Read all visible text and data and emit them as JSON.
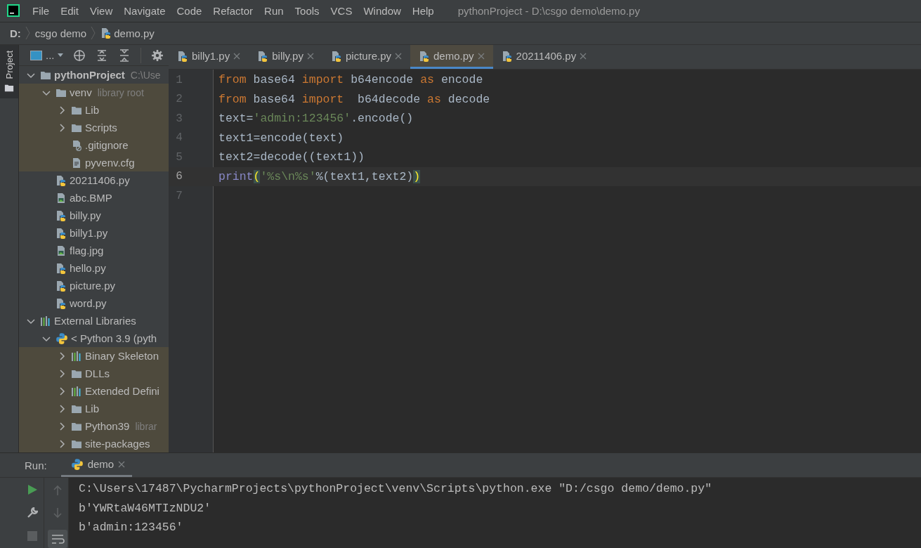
{
  "menu": [
    "File",
    "Edit",
    "View",
    "Navigate",
    "Code",
    "Refactor",
    "Run",
    "Tools",
    "VCS",
    "Window",
    "Help"
  ],
  "window": {
    "title": "pythonProject - D:\\csgo demo\\demo.py"
  },
  "breadcrumb": [
    {
      "label": "D:",
      "kind": "drive"
    },
    {
      "label": "csgo demo",
      "kind": "folder"
    },
    {
      "label": "demo.py",
      "kind": "python"
    }
  ],
  "side_tab": {
    "label": "Project",
    "selected": true
  },
  "project_toolbar": {
    "view_label": "..."
  },
  "tree": [
    {
      "label": "pythonProject",
      "hint": "C:\\Use",
      "kind": "folder",
      "expanded": true,
      "library": false,
      "bold": true,
      "children": [
        {
          "label": "venv",
          "hint": "library root",
          "kind": "folder",
          "expanded": true,
          "library": true,
          "children": [
            {
              "label": "Lib",
              "kind": "folder",
              "expanded": false,
              "library": true
            },
            {
              "label": "Scripts",
              "kind": "folder",
              "expanded": false,
              "library": true
            },
            {
              "label": ".gitignore",
              "kind": "ignored",
              "library": true
            },
            {
              "label": "pyvenv.cfg",
              "kind": "text",
              "library": true
            }
          ]
        },
        {
          "label": "20211406.py",
          "kind": "python",
          "library": false
        },
        {
          "label": "abc.BMP",
          "kind": "image",
          "library": false
        },
        {
          "label": "billy.py",
          "kind": "python",
          "library": false
        },
        {
          "label": "billy1.py",
          "kind": "python",
          "library": false
        },
        {
          "label": "flag.jpg",
          "kind": "image",
          "library": false
        },
        {
          "label": "hello.py",
          "kind": "python",
          "library": false
        },
        {
          "label": "picture.py",
          "kind": "python",
          "library": false
        },
        {
          "label": "word.py",
          "kind": "python",
          "library": false
        }
      ]
    },
    {
      "label": "External Libraries",
      "kind": "libraries",
      "expanded": true,
      "library": false,
      "children": [
        {
          "label": "< Python 3.9 (pyth",
          "kind": "sdk",
          "expanded": true,
          "library": false,
          "children": [
            {
              "label": "Binary Skeleton",
              "kind": "libraries",
              "expanded": false,
              "library": true
            },
            {
              "label": "DLLs",
              "kind": "folder",
              "expanded": false,
              "library": true
            },
            {
              "label": "Extended Defini",
              "kind": "libraries",
              "expanded": false,
              "library": true
            },
            {
              "label": "Lib",
              "kind": "folder",
              "expanded": false,
              "library": true
            },
            {
              "label": "Python39",
              "hint": "librar",
              "kind": "folder",
              "expanded": false,
              "library": true
            },
            {
              "label": "site-packages",
              "kind": "folder",
              "expanded": false,
              "library": true
            }
          ]
        }
      ]
    }
  ],
  "tabs": [
    {
      "label": "billy1.py",
      "selected": false
    },
    {
      "label": "billy.py",
      "selected": false
    },
    {
      "label": "picture.py",
      "selected": false
    },
    {
      "label": "demo.py",
      "selected": true
    },
    {
      "label": "20211406.py",
      "selected": false
    }
  ],
  "code": [
    {
      "number": "1",
      "current": false,
      "tokens": [
        {
          "text": "from",
          "kind": "keyword"
        },
        {
          "text": " base64 ",
          "kind": "plain"
        },
        {
          "text": "import",
          "kind": "keyword"
        },
        {
          "text": " b64encode ",
          "kind": "plain"
        },
        {
          "text": "as",
          "kind": "keyword"
        },
        {
          "text": " encode",
          "kind": "plain"
        }
      ]
    },
    {
      "number": "2",
      "current": false,
      "tokens": [
        {
          "text": "from",
          "kind": "keyword"
        },
        {
          "text": " base64 ",
          "kind": "plain"
        },
        {
          "text": "import",
          "kind": "keyword"
        },
        {
          "text": "  b64decode ",
          "kind": "plain"
        },
        {
          "text": "as",
          "kind": "keyword"
        },
        {
          "text": " decode",
          "kind": "plain"
        }
      ]
    },
    {
      "number": "3",
      "current": false,
      "tokens": [
        {
          "text": "text=",
          "kind": "plain"
        },
        {
          "text": "'admin:123456'",
          "kind": "string"
        },
        {
          "text": ".encode()",
          "kind": "plain"
        }
      ]
    },
    {
      "number": "4",
      "current": false,
      "tokens": [
        {
          "text": "text1=encode(text)",
          "kind": "plain"
        }
      ]
    },
    {
      "number": "5",
      "current": false,
      "tokens": [
        {
          "text": "text2=decode((text1))",
          "kind": "plain"
        }
      ]
    },
    {
      "number": "6",
      "current": true,
      "tokens": [
        {
          "text": "print",
          "kind": "builtin"
        },
        {
          "text": "(",
          "kind": "brace"
        },
        {
          "text": "'%s\\n%s'",
          "kind": "string"
        },
        {
          "text": "%(text1,text2)",
          "kind": "plain"
        },
        {
          "text": ")",
          "kind": "brace"
        }
      ]
    },
    {
      "number": "7",
      "current": false
    }
  ],
  "run": {
    "label": "Run:",
    "tab": {
      "label": "demo",
      "selected": true
    },
    "output": [
      "C:\\Users\\17487\\PycharmProjects\\pythonProject\\venv\\Scripts\\python.exe \"D:/csgo demo/demo.py\"",
      "b'YWRtaW46MTIzNDU2'",
      "b'admin:123456'"
    ]
  }
}
